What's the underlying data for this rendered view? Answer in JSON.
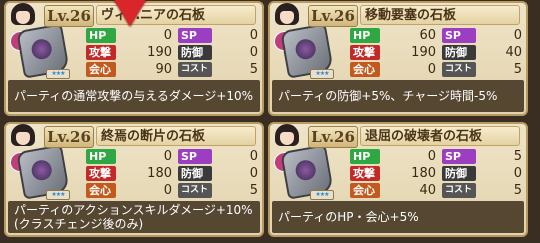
{
  "cards": [
    {
      "level": "Lv.26",
      "name": "ヴィ…ニアの石板",
      "heart": "1",
      "stars": "★★★",
      "stats": {
        "hp_label": "HP",
        "hp": "0",
        "sp_label": "SP",
        "sp": "0",
        "atk_label": "攻撃",
        "atk": "190",
        "def_label": "防御",
        "def": "0",
        "crit_label": "会心",
        "crit": "90",
        "cost_label": "コスト",
        "cost": "5"
      },
      "desc": "パーティの通常攻撃の与えるダメージ+10%"
    },
    {
      "level": "Lv.26",
      "name": "移動要塞の石板",
      "heart": "1",
      "stars": "★★★",
      "stats": {
        "hp_label": "HP",
        "hp": "60",
        "sp_label": "SP",
        "sp": "0",
        "atk_label": "攻撃",
        "atk": "190",
        "def_label": "防御",
        "def": "40",
        "crit_label": "会心",
        "crit": "0",
        "cost_label": "コスト",
        "cost": "5"
      },
      "desc": "パーティの防御+5%、チャージ時間-5%"
    },
    {
      "level": "Lv.26",
      "name": "終焉の断片の石板",
      "heart": "1",
      "stars": "★★★",
      "stats": {
        "hp_label": "HP",
        "hp": "0",
        "sp_label": "SP",
        "sp": "0",
        "atk_label": "攻撃",
        "atk": "180",
        "def_label": "防御",
        "def": "0",
        "crit_label": "会心",
        "crit": "0",
        "cost_label": "コスト",
        "cost": "5"
      },
      "desc": "パーティのアクションスキルダメージ+10% (クラスチェンジ後のみ)"
    },
    {
      "level": "Lv.26",
      "name": "退屈の破壊者の石板",
      "heart": "1",
      "stars": "★★★",
      "stats": {
        "hp_label": "HP",
        "hp": "0",
        "sp_label": "SP",
        "sp": "5",
        "atk_label": "攻撃",
        "atk": "180",
        "def_label": "防御",
        "def": "0",
        "crit_label": "会心",
        "crit": "40",
        "cost_label": "コスト",
        "cost": "5"
      },
      "desc": "パーティのHP・会心+5%"
    }
  ],
  "colors": {
    "card_bg": "#efe4c8",
    "hp": "#2fa743",
    "sp": "#9b3ec2",
    "atk": "#c22a2a",
    "crit": "#c25a1e",
    "arrow": "#d8262a"
  }
}
